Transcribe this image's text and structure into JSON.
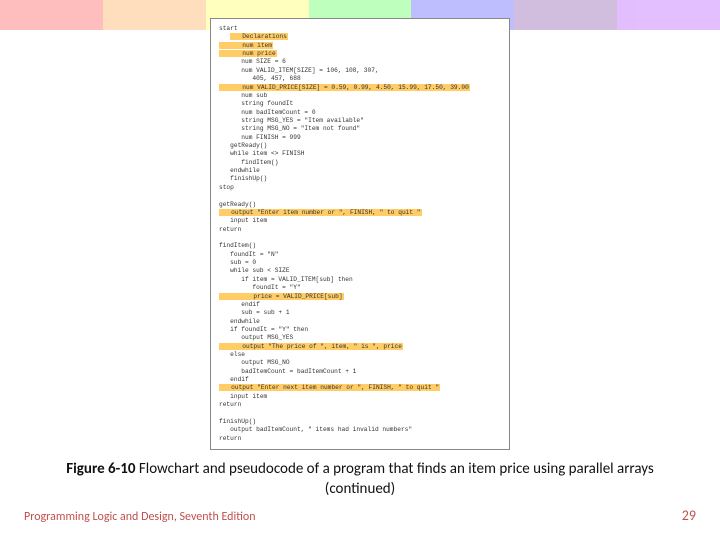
{
  "code": {
    "l01": "start",
    "l02": "   Declarations",
    "l03": "      num item",
    "l04": "      num price",
    "l05": "      num SIZE = 6",
    "l06": "      num VALID_ITEM[SIZE] = 106, 108, 307,",
    "l07": "         405, 457, 688",
    "l08": "      num VALID_PRICE[SIZE] = 0.59, 0.99, 4.50, 15.99, 17.50, 39.00",
    "l09": "      num sub",
    "l10": "      string foundIt",
    "l11": "      num badItemCount = 0",
    "l12": "      string MSG_YES = \"Item available\"",
    "l13": "      string MSG_NO = \"Item not found\"",
    "l14": "      num FINISH = 999",
    "l15": "   getReady()",
    "l16": "   while item <> FINISH",
    "l17": "      findItem()",
    "l18": "   endwhile",
    "l19": "   finishUp()",
    "l20": "stop",
    "l21": "",
    "l22": "getReady()",
    "l23": "   output \"Enter item number or \", FINISH, \" to quit \"",
    "l24": "   input item",
    "l25": "return",
    "l26": "",
    "l27": "findItem()",
    "l28": "   foundIt = \"N\"",
    "l29": "   sub = 0",
    "l30": "   while sub < SIZE",
    "l31": "      if item = VALID_ITEM[sub] then",
    "l32": "         foundIt = \"Y\"",
    "l33": "         price = VALID_PRICE[sub]",
    "l34": "      endif",
    "l35": "      sub = sub + 1",
    "l36": "   endwhile",
    "l37": "   if foundIt = \"Y\" then",
    "l38": "      output MSG_YES",
    "l39": "      output \"The price of \", item, \" is \", price",
    "l40": "   else",
    "l41": "      output MSG_NO",
    "l42": "      badItemCount = badItemCount + 1",
    "l43": "   endif",
    "l44": "   output \"Enter next item number or \", FINISH, \" to quit \"",
    "l45": "   input item",
    "l46": "return",
    "l47": "",
    "l48": "finishUp()",
    "l49": "   output badItemCount, \" items had invalid numbers\"",
    "l50": "return"
  },
  "caption": {
    "fig_label": "Figure 6-10",
    "text": " Flowchart and pseudocode of a program that finds an item price using parallel arrays (continued)"
  },
  "footer": {
    "left": "Programming Logic and Design, Seventh Edition",
    "right": "29"
  },
  "colors": {
    "rainbow": [
      "#ff0000",
      "#ff7f00",
      "#ffff00",
      "#00ff00",
      "#0000ff",
      "#4b0082",
      "#8f00ff"
    ]
  }
}
